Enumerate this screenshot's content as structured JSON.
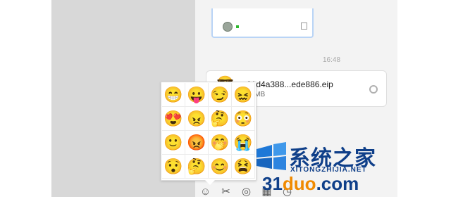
{
  "window": {
    "title": ""
  },
  "chat": {
    "timestamp": "16:48",
    "file": {
      "name": "01d4a388...ede886.eip",
      "size": "26MB",
      "sender_icon": "sunglasses-face"
    }
  },
  "emoji_picker": {
    "rows": [
      [
        "😁",
        "😛",
        "😏",
        "😖"
      ],
      [
        "😍",
        "😠",
        "🤔",
        "😳"
      ],
      [
        "🙂",
        "😡",
        "🤭",
        "😭"
      ],
      [
        "😯",
        "🤔",
        "😊",
        "😫"
      ]
    ]
  },
  "toolbar": {
    "items": [
      {
        "label": "☺",
        "icon": "smiley-icon"
      },
      {
        "label": "✂",
        "icon": "scissors-icon"
      },
      {
        "label": "◎",
        "icon": "screenshot-icon"
      },
      {
        "label": "▦",
        "icon": "image-icon"
      },
      {
        "label": "◷",
        "icon": "clock-icon"
      }
    ]
  },
  "watermark": {
    "title": "系统之家",
    "subtitle": "XITONGZHIJIA.NET",
    "domain_num": "31",
    "domain_mid": "duo",
    "domain_tail": ".com"
  },
  "colors": {
    "left_pane": "#d8d8d8",
    "chat_bg": "#f3f3f3",
    "accent_border": "#b9d4f6",
    "watermark_blue": "#0f3f89",
    "watermark_orange": "#f08a00"
  }
}
